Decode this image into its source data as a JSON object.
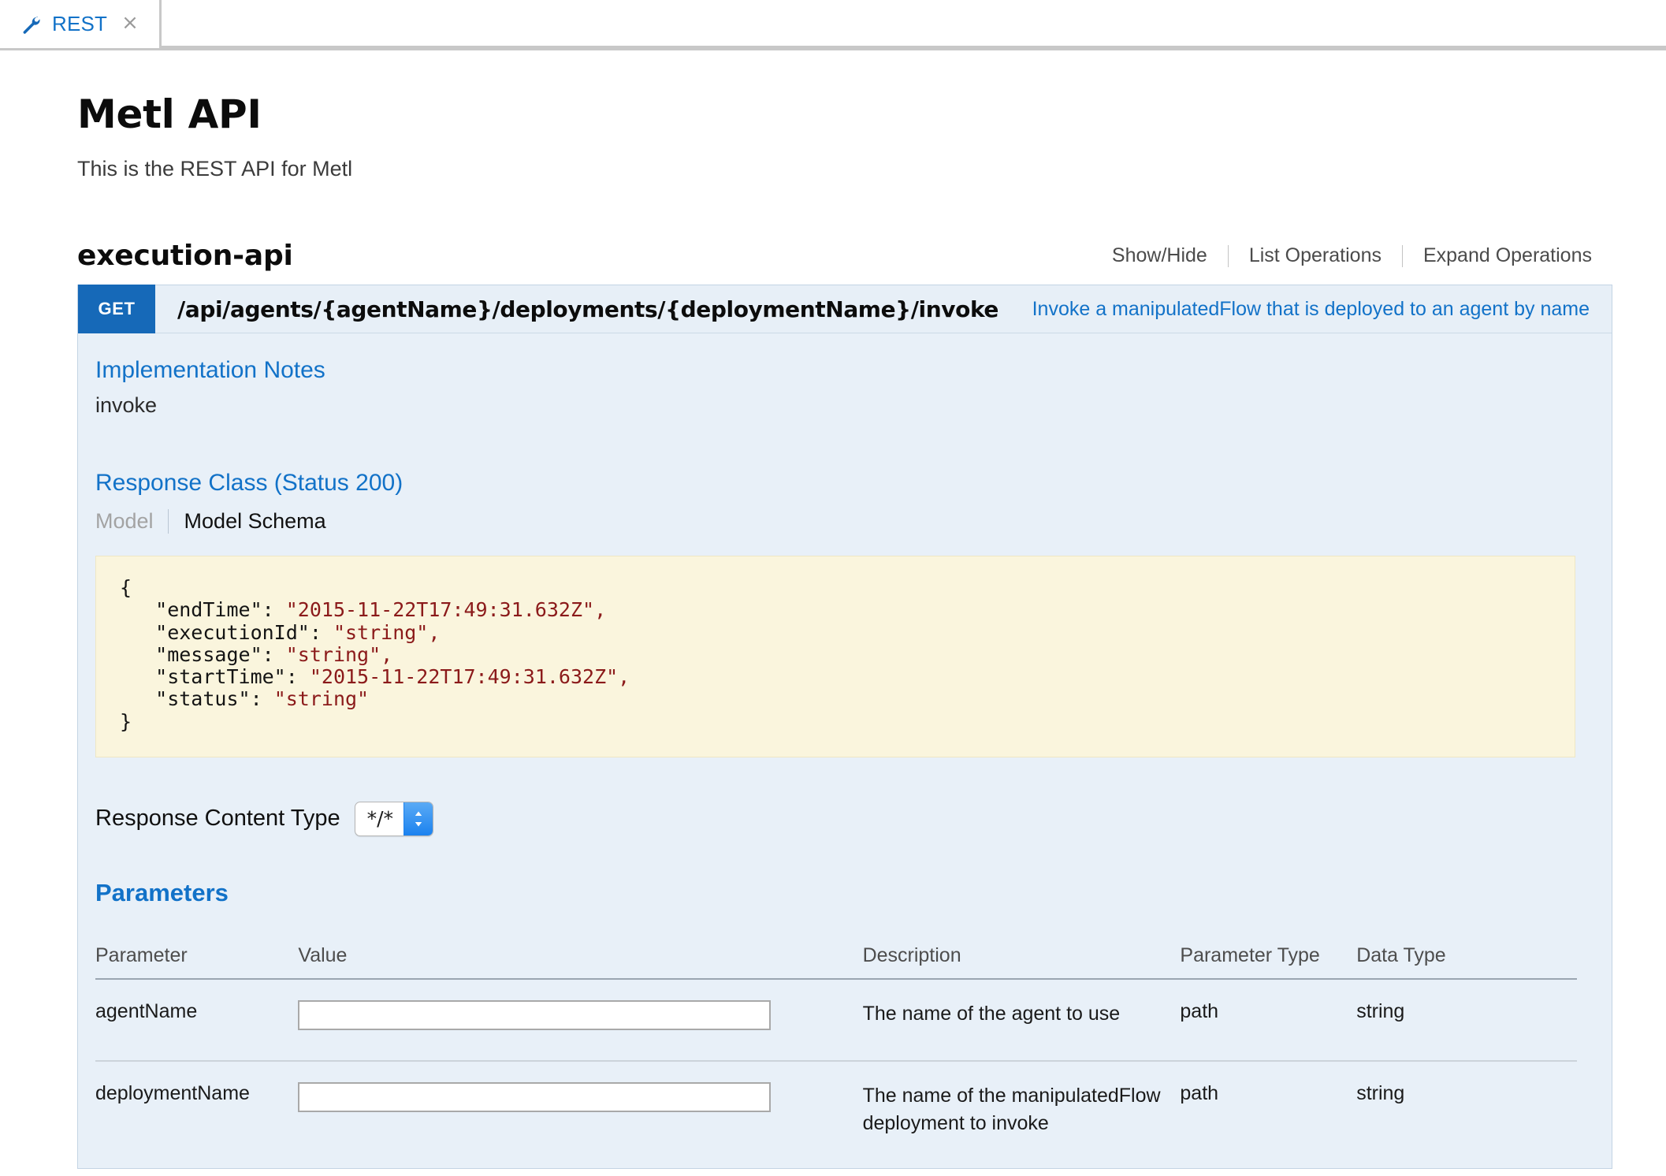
{
  "tabbar": {
    "tabs": [
      {
        "icon": "wrench-icon",
        "label": "REST",
        "close": "×"
      }
    ]
  },
  "page": {
    "title": "Metl API",
    "subtitle": "This is the REST API for Metl"
  },
  "resource": {
    "name": "execution-api",
    "options": [
      {
        "label": "Show/Hide"
      },
      {
        "label": "List Operations"
      },
      {
        "label": "Expand Operations"
      }
    ]
  },
  "operation": {
    "method": "GET",
    "path": "/api/agents/{agentName}/deployments/{deploymentName}/invoke",
    "summary": "Invoke a manipulatedFlow that is deployed to an agent by name",
    "implementation_notes": {
      "heading": "Implementation Notes",
      "text": "invoke"
    },
    "response_class": {
      "heading": "Response Class (Status 200)",
      "tabs": [
        {
          "label": "Model",
          "active": false
        },
        {
          "label": "Model Schema",
          "active": true
        }
      ],
      "schema": {
        "open_brace": "{",
        "close_brace": "}",
        "lines": [
          {
            "key": "\"endTime\":",
            "value": "\"2015-11-22T17:49:31.632Z\","
          },
          {
            "key": "\"executionId\":",
            "value": "\"string\","
          },
          {
            "key": "\"message\":",
            "value": "\"string\","
          },
          {
            "key": "\"startTime\":",
            "value": "\"2015-11-22T17:49:31.632Z\","
          },
          {
            "key": "\"status\":",
            "value": "\"string\""
          }
        ]
      }
    },
    "response_content_type": {
      "label": "Response Content Type",
      "selected": "*/*",
      "options": [
        "*/*"
      ]
    },
    "parameters": {
      "heading": "Parameters",
      "columns": [
        "Parameter",
        "Value",
        "Description",
        "Parameter Type",
        "Data Type"
      ],
      "rows": [
        {
          "name": "agentName",
          "value": "",
          "placeholder": "",
          "description": "The name of the agent to use",
          "param_type": "path",
          "data_type": "string"
        },
        {
          "name": "deploymentName",
          "value": "",
          "placeholder": "",
          "description": "The name of the manipulatedFlow deployment to invoke",
          "param_type": "path",
          "data_type": "string"
        }
      ]
    }
  },
  "colors": {
    "accent_blue": "#1272c8",
    "method_get": "#1669b8",
    "panel_bg": "#e8f0f8",
    "code_bg": "#faf5dd",
    "code_string": "#8b1a1a"
  }
}
